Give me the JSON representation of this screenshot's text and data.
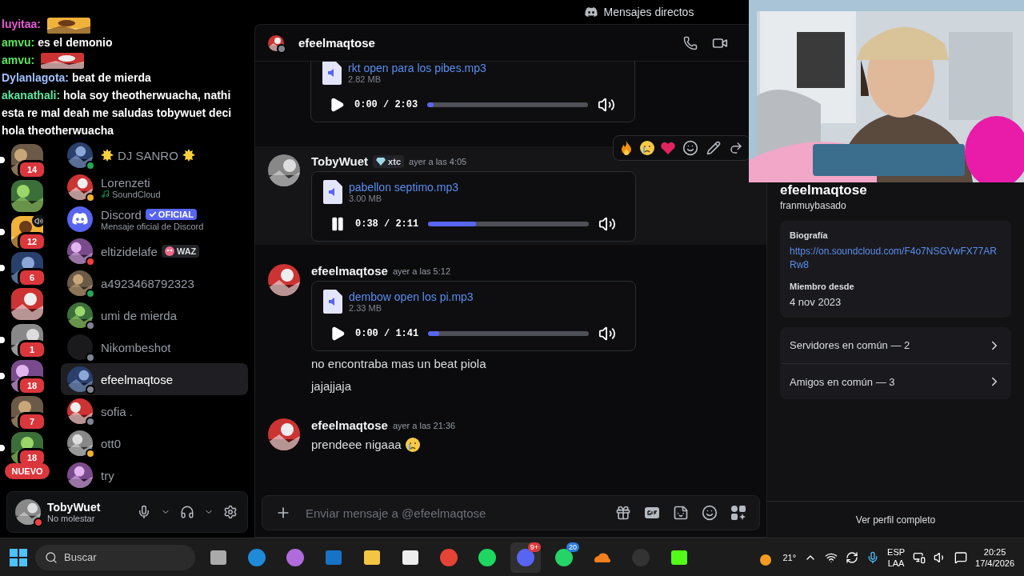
{
  "stream_chat": [
    {
      "user": "luyitaa:",
      "color": "#e85ad6",
      "emote": true
    },
    {
      "user": "amvu:",
      "color": "#5ee35e",
      "message": "es el demonio"
    },
    {
      "user": "amvu:",
      "color": "#5ee35e",
      "emote": true
    },
    {
      "user": "Dylanlagota:",
      "color": "#9fc1ff",
      "message": "beat de mierda"
    },
    {
      "user": "akanathali:",
      "color": "#5ee6a0",
      "message": "hola soy theotherwuacha, nathi esta re mal deah me saludas tobywuet deci hola theotherwuacha"
    }
  ],
  "servers": [
    {
      "kind": "picture",
      "unread": true,
      "badge": "14"
    },
    {
      "kind": "picture"
    },
    {
      "kind": "picture",
      "unread": true,
      "badge": "12",
      "voice": true
    },
    {
      "kind": "picture",
      "unread": true,
      "badge": "6"
    },
    {
      "kind": "picture"
    },
    {
      "kind": "picture",
      "unread": true,
      "badge": "1"
    },
    {
      "kind": "picture",
      "unread": true,
      "badge": "18"
    },
    {
      "kind": "picture",
      "badge": "7"
    },
    {
      "kind": "picture",
      "unread": true,
      "badge": "18"
    },
    {
      "kind": "new",
      "label": "NUEVO"
    }
  ],
  "dms": [
    {
      "kind": "picture",
      "name": "DJ SANRO",
      "color": "#23a55a",
      "sun_decor": true,
      "selected": false
    },
    {
      "kind": "picture",
      "name": "Lorenzeti",
      "color": "#f0b232",
      "activity": "SoundCloud",
      "selected": false
    },
    {
      "kind": "discord",
      "name": "Discord",
      "official_tag": "OFICIAL",
      "subtitle": "Mensaje oficial de Discord",
      "selected": false
    },
    {
      "kind": "picture",
      "name": "eltizidelafe",
      "color": "#f23f43",
      "tag": "WAZ",
      "selected": false
    },
    {
      "kind": "picture",
      "name": "a4923468792323",
      "color": "#23a55a",
      "selected": false
    },
    {
      "kind": "picture",
      "name": "umi de mierda",
      "color": "#80848e",
      "selected": false
    },
    {
      "kind": "blank",
      "name": "Nikombeshot",
      "color": "#80848e",
      "selected": false
    },
    {
      "kind": "picture",
      "name": "efeelmaqtose",
      "color": "#80848e",
      "selected": true
    },
    {
      "kind": "picture",
      "name": "sofia .",
      "color": "#80848e",
      "selected": false
    },
    {
      "kind": "picture",
      "name": "ott0",
      "color": "#f0b232",
      "selected": false
    },
    {
      "kind": "picture",
      "name": "try",
      "selected": false
    }
  ],
  "user_panel": {
    "name": "TobyWuet",
    "status_text": "No molestar",
    "color": "#f23f43"
  },
  "title_bar": {
    "title": "Mensajes directos"
  },
  "chat_header": {
    "name": "efeelmaqtose",
    "color": "#80848e"
  },
  "messages": [
    {
      "continued": true,
      "attachment": {
        "file": "rkt open para los pibes.mp3",
        "size": "2.82 MB",
        "time": "0:00 / 2:03",
        "playing": false,
        "level": 0.04
      }
    },
    {
      "hovered": true,
      "author": "TobyWuet",
      "tag": "xtc",
      "time": "ayer a las 4:05",
      "attachment": {
        "file": "pabellon septimo.mp3",
        "size": "3.00 MB",
        "time": "0:38 / 2:11",
        "playing": true,
        "level": 0.3
      }
    },
    {
      "author": "efeelmaqtose",
      "time": "ayer a las 5:12",
      "attachment": {
        "file": "dembow open los pi.mp3",
        "size": "2.33 MB",
        "time": "0:00 / 1:41",
        "playing": false,
        "level": 0.07
      },
      "lines": [
        {
          "text": "no encontraba mas un beat piola"
        },
        {
          "text": "jajajjaja"
        }
      ]
    },
    {
      "author": "efeelmaqtose",
      "time": "ayer a las 21:36",
      "lines": [
        {
          "text": "prendeee nigaaa",
          "emoji": true
        }
      ]
    }
  ],
  "composer": {
    "placeholder": "Enviar mensaje a @efeelmaqtose"
  },
  "profile": {
    "name": "efeelmaqtose",
    "username": "franmuybasado",
    "bio_label": "Biografía",
    "bio_link": "https://on.soundcloud.com/F4o7NSGVwFX77ARRw8",
    "member_label": "Miembro desde",
    "member_date": "4 nov 2023",
    "common": [
      "Servidores en común — 2",
      "Amigos en común — 3"
    ],
    "footer_button": "Ver perfil completo"
  },
  "taskbar": {
    "search_placeholder": "Buscar",
    "apps": [
      {
        "kind": "taskview",
        "selected": false
      },
      {
        "kind": "edge",
        "selected": false
      },
      {
        "kind": "copilot",
        "selected": false
      },
      {
        "kind": "mail",
        "selected": false
      },
      {
        "kind": "folder",
        "selected": false
      },
      {
        "kind": "store",
        "selected": false
      },
      {
        "kind": "chrome",
        "selected": false
      },
      {
        "kind": "spotify",
        "selected": false
      },
      {
        "kind": "discord",
        "selected": true,
        "badge": "9+"
      },
      {
        "kind": "whatsapp",
        "selected": false,
        "badge": "20"
      },
      {
        "kind": "cloud",
        "selected": false
      },
      {
        "kind": "obs",
        "selected": false
      },
      {
        "kind": "kick",
        "selected": false
      }
    ],
    "weather": "21°",
    "lang": "ESP",
    "layout": "LAA",
    "time": "20:25",
    "date": "17/4/2026"
  }
}
